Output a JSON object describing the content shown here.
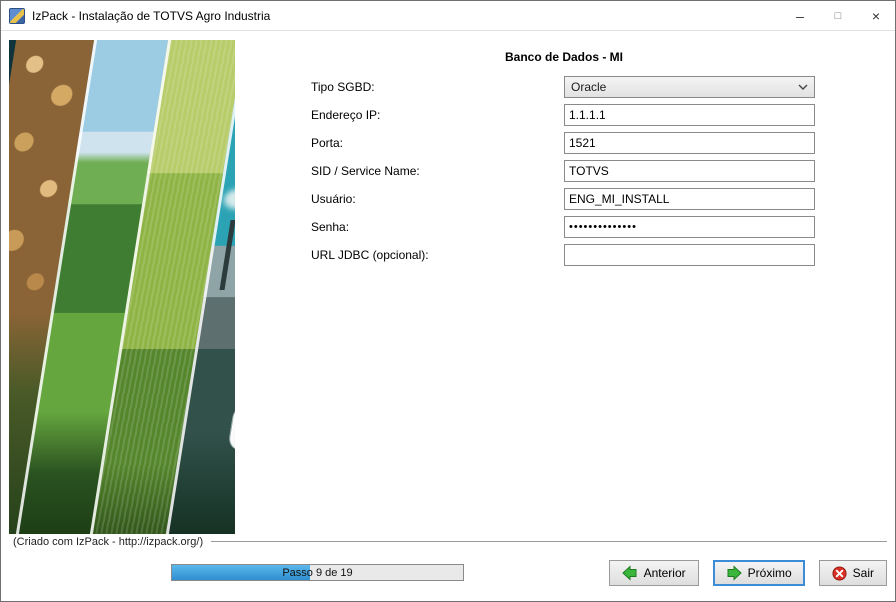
{
  "window": {
    "title": "IzPack - Instalação de TOTVS Agro Industria",
    "controls": {
      "minimize": "–",
      "maximize": "□",
      "close": "×"
    }
  },
  "content": {
    "heading": "Banco de Dados - MI",
    "fields": [
      {
        "label": "Tipo SGBD:",
        "value": "Oracle"
      },
      {
        "label": "Endereço IP:",
        "value": "1.1.1.1"
      },
      {
        "label": "Porta:",
        "value": "1521"
      },
      {
        "label": "SID / Service Name:",
        "value": "TOTVS"
      },
      {
        "label": "Usuário:",
        "value": "ENG_MI_INSTALL"
      },
      {
        "label": "Senha:",
        "value": "••••••••••••••"
      },
      {
        "label": "URL JDBC (opcional):",
        "value": ""
      }
    ]
  },
  "footer": {
    "credit": "(Criado com IzPack - http://izpack.org/)",
    "progress": {
      "label": "Passo 9 de 19",
      "current": 9,
      "total": 19,
      "fill_style": "width:47.4%"
    },
    "buttons": {
      "anterior": "Anterior",
      "proximo": "Próximo",
      "sair": "Sair"
    },
    "colors": {
      "progress_fill": "#2e8fd0",
      "arrow_green": "#3cb53c",
      "quit_red": "#d93025"
    }
  }
}
